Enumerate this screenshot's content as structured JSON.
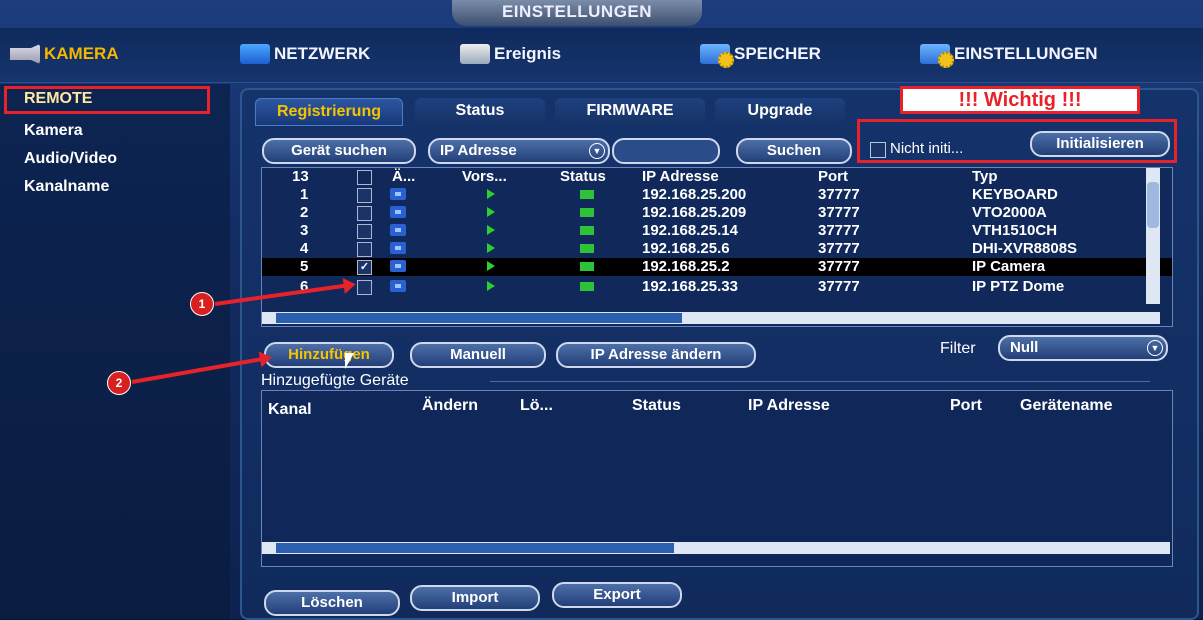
{
  "title": "EINSTELLUNGEN",
  "nav": [
    {
      "label": "KAMERA",
      "icon": "camera-icon"
    },
    {
      "label": "NETZWERK",
      "icon": "network-icon"
    },
    {
      "label": "Ereignis",
      "icon": "event-icon"
    },
    {
      "label": "SPEICHER",
      "icon": "storage-icon"
    },
    {
      "label": "EINSTELLUNGEN",
      "icon": "settings-icon"
    }
  ],
  "sidebar": {
    "items": [
      "REMOTE",
      "Kamera",
      "Audio/Video",
      "Kanalname"
    ]
  },
  "tabs": [
    "Registrierung",
    "Status",
    "FIRMWARE",
    "Upgrade"
  ],
  "note": "!!! Wichtig !!!",
  "toolbar": {
    "search_device": "Gerät suchen",
    "address_type": "IP Adresse",
    "search_field": "",
    "search_button": "Suchen",
    "uninit_label": "Nicht initi...",
    "initialize_button": "Initialisieren"
  },
  "device_table": {
    "count": "13",
    "headers": [
      "Ä...",
      "Vors...",
      "Status",
      "IP Adresse",
      "Port",
      "Typ"
    ],
    "rows": [
      {
        "no": "1",
        "ip": "192.168.25.200",
        "port": "37777",
        "type": "KEYBOARD",
        "checked": false
      },
      {
        "no": "2",
        "ip": "192.168.25.209",
        "port": "37777",
        "type": "VTO2000A",
        "checked": false
      },
      {
        "no": "3",
        "ip": "192.168.25.14",
        "port": "37777",
        "type": "VTH1510CH",
        "checked": false
      },
      {
        "no": "4",
        "ip": "192.168.25.6",
        "port": "37777",
        "type": "DHI-XVR8808S",
        "checked": false
      },
      {
        "no": "5",
        "ip": "192.168.25.2",
        "port": "37777",
        "type": "IP Camera",
        "checked": true
      },
      {
        "no": "6",
        "ip": "192.168.25.33",
        "port": "37777",
        "type": "IP PTZ Dome",
        "checked": false
      }
    ]
  },
  "actions": {
    "add": "Hinzufügen",
    "manual": "Manuell",
    "change_ip": "IP Adresse ändern",
    "filter_label": "Filter",
    "filter_value": "Null"
  },
  "added_devices": {
    "title": "Hinzugefügte Geräte",
    "headers": [
      "Kanal",
      "Ändern",
      "Lö...",
      "Status",
      "IP Adresse",
      "Port",
      "Gerätename"
    ]
  },
  "bottom": {
    "delete": "Löschen",
    "import": "Import",
    "export": "Export"
  },
  "annotations": {
    "step1": "1",
    "step2": "2"
  },
  "colors": {
    "highlight": "#f5c400",
    "annotation_red": "#e8222a",
    "status_green": "#2cc23a"
  }
}
